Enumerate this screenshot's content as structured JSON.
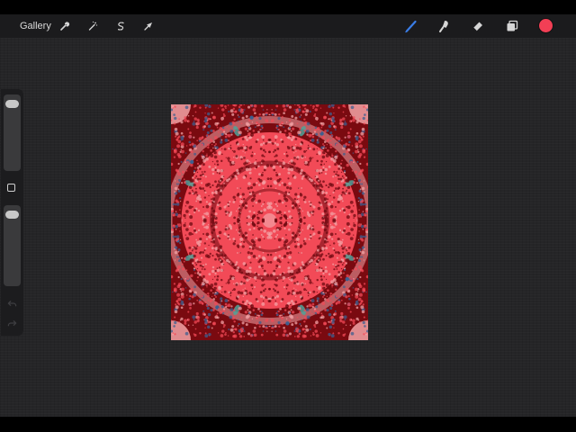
{
  "toolbar": {
    "gallery_label": "Gallery",
    "left_tools": [
      {
        "name": "actions",
        "icon": "wrench-icon"
      },
      {
        "name": "adjustments",
        "icon": "magic-wand-icon"
      },
      {
        "name": "selection",
        "icon": "selection-s-icon"
      },
      {
        "name": "transform",
        "icon": "arrow-cursor-icon"
      }
    ],
    "right_tools": [
      {
        "name": "brush",
        "icon": "brush-icon",
        "active": true
      },
      {
        "name": "smudge",
        "icon": "smudge-finger-icon",
        "active": false
      },
      {
        "name": "eraser",
        "icon": "eraser-icon",
        "active": false
      },
      {
        "name": "layers",
        "icon": "layers-icon",
        "active": false
      }
    ],
    "current_color": "#f23f55",
    "active_tool_color": "#3a7de6"
  },
  "sidebar": {
    "brush_size_level": 0.05,
    "opacity_level": 0.05,
    "modify_icon": "square-icon",
    "undo_icon": "undo-arrow-icon",
    "redo_icon": "redo-arrow-icon"
  },
  "canvas": {
    "artwork": "radial-kaleidoscope-pattern",
    "colors": {
      "background": "#7a0a10",
      "center": "#f24a57",
      "light_ring": "#f3a3a6",
      "teal_accent": "#4fa39a",
      "blue_accent": "#3d5f8f",
      "dark_ring": "#6e0a10"
    }
  }
}
